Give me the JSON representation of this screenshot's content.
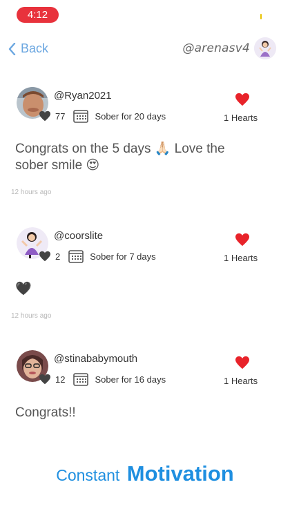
{
  "status": {
    "time": "4:12"
  },
  "nav": {
    "back_label": "Back",
    "my_handle": "@arenasv4"
  },
  "posts": [
    {
      "username": "@Ryan2021",
      "likes": "77",
      "sober_text": "Sober for 20 days",
      "hearts_text": "1 Hearts",
      "body": "Congrats on the 5 days 🙏🏻 Love the sober smile 😍",
      "time_ago": "12 hours ago"
    },
    {
      "username": "@coorslite",
      "likes": "2",
      "sober_text": "Sober for 7 days",
      "hearts_text": "1 Hearts",
      "body": "🖤",
      "time_ago": "12 hours ago"
    },
    {
      "username": "@stinababymouth",
      "likes": "12",
      "sober_text": "Sober for 16 days",
      "hearts_text": "1 Hearts",
      "body": "Congrats!!",
      "time_ago": ""
    }
  ],
  "tagline": {
    "part1": "Constant",
    "part2": "Motivation"
  },
  "colors": {
    "accent": "#1f8fe0",
    "heart": "#e8232a",
    "back": "#6aa6e0",
    "status_pill": "#e8323c"
  }
}
